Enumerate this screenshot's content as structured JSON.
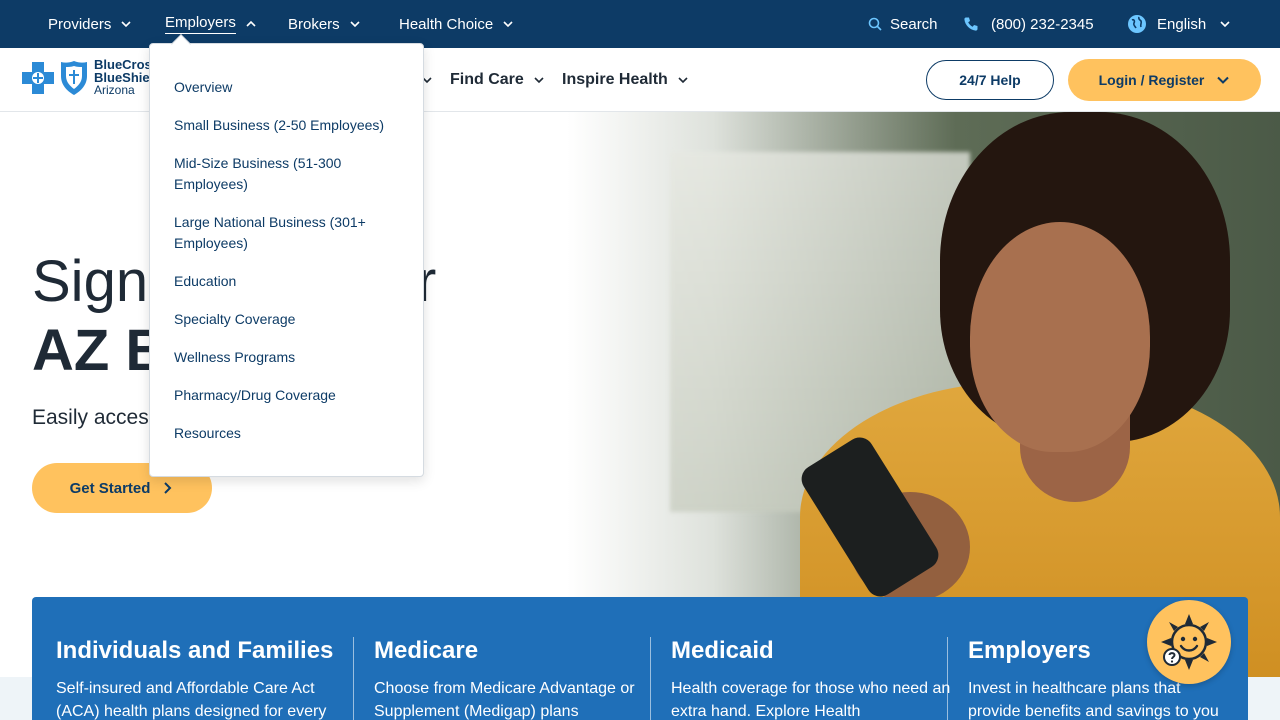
{
  "topbar": {
    "nav": [
      {
        "label": "Providers"
      },
      {
        "label": "Employers"
      },
      {
        "label": "Brokers"
      },
      {
        "label": "Health Choice"
      }
    ],
    "search_label": "Search",
    "phone": "(800) 232-2345",
    "language": "English"
  },
  "logo": {
    "line1": "BlueCross",
    "line2": "BlueShield",
    "line3": "Arizona"
  },
  "mainnav": {
    "find_care": "Find Care",
    "inspire_health": "Inspire Health",
    "help_button": "24/7 Help",
    "login_button": "Login / Register"
  },
  "employers_menu": [
    "Overview",
    "Small Business (2-50 Employees)",
    "Mid-Size Business (51-300 Employees)",
    "Large National Business (301+ Employees)",
    "Education",
    "Specialty Coverage",
    "Wellness Programs",
    "Pharmacy/Drug Coverage",
    "Resources"
  ],
  "hero": {
    "title_start": "Sign",
    "title_end": "r",
    "title_line2": "AZ B",
    "subtitle": "Easily access",
    "cta": "Get Started"
  },
  "cards": [
    {
      "title": "Individuals and Families",
      "text": "Self-insured and Affordable Care Act (ACA) health plans designed for every"
    },
    {
      "title": "Medicare",
      "text": "Choose from Medicare Advantage or Supplement (Medigap) plans"
    },
    {
      "title": "Medicaid",
      "text": "Health coverage for those who need an extra hand. Explore Health"
    },
    {
      "title": "Employers",
      "text": "Invest in healthcare plans that provide benefits and savings to you"
    }
  ],
  "colors": {
    "topbar": "#0d3b66",
    "accent": "#ffc25e",
    "band": "#1f6fb8"
  }
}
